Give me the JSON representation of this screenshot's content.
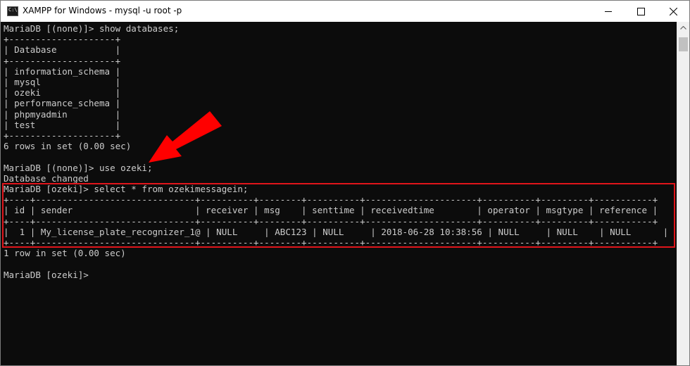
{
  "window": {
    "icon_glyph": "C:\\",
    "title": "XAMPP for Windows - mysql  -u root -p",
    "controls": [
      "minimize-icon",
      "maximize-icon",
      "close-icon"
    ]
  },
  "console": {
    "lines": [
      "MariaDB [(none)]> show databases;",
      "+--------------------+",
      "| Database           |",
      "+--------------------+",
      "| information_schema |",
      "| mysql              |",
      "| ozeki              |",
      "| performance_schema |",
      "| phpmyadmin         |",
      "| test               |",
      "+--------------------+",
      "6 rows in set (0.00 sec)",
      "",
      "MariaDB [(none)]> use ozeki;",
      "Database changed",
      "MariaDB [ozeki]> select * from ozekimessagein;",
      "+----+------------------------------+----------+--------+----------+---------------------+----------+---------+-----------+",
      "| id | sender                       | receiver | msg    | senttime | receivedtime        | operator | msgtype | reference |",
      "+----+------------------------------+----------+--------+----------+---------------------+----------+---------+-----------+",
      "|  1 | My_license_plate_recognizer_1@ | NULL     | ABC123 | NULL     | 2018-06-28 10:38:56 | NULL     | NULL    | NULL      |",
      "+----+------------------------------+----------+--------+----------+---------------------+----------+---------+-----------+",
      "1 row in set (0.00 sec)",
      "",
      "MariaDB [ozeki]>"
    ]
  },
  "annotations": {
    "arrow_color": "#ff0000",
    "highlight_color": "#e0151b"
  },
  "colors": {
    "console_bg": "#0c0c0c",
    "console_text": "#cccccc"
  }
}
